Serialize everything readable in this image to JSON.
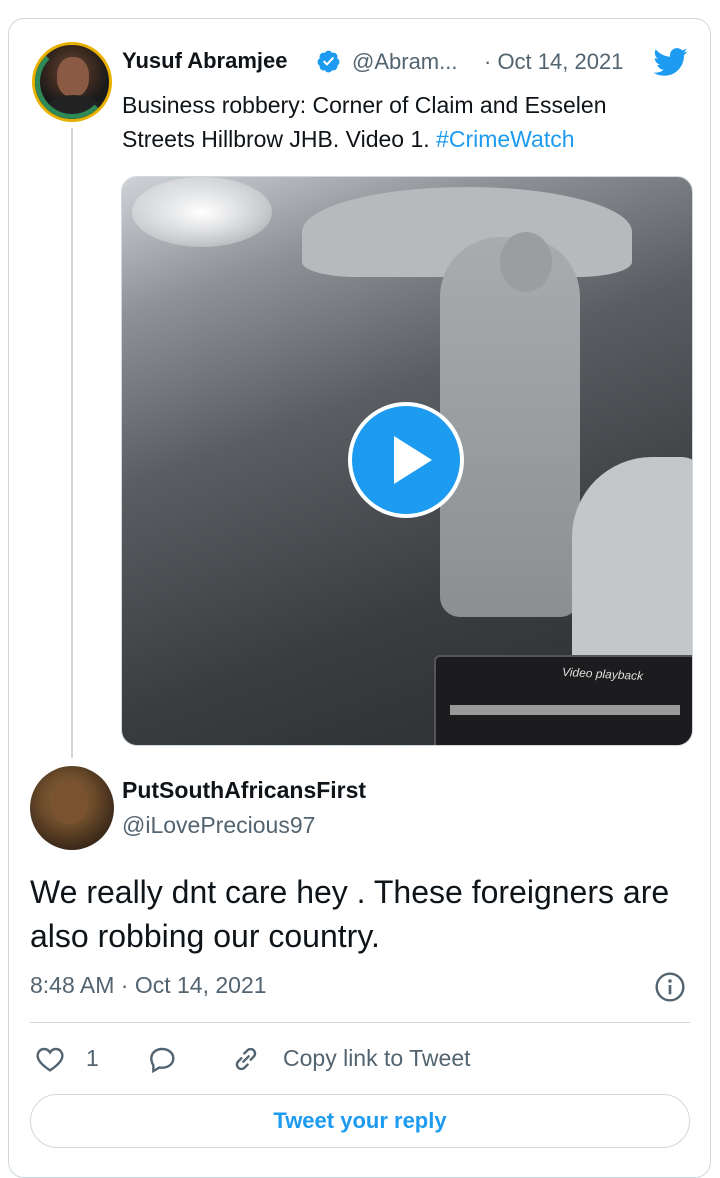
{
  "colors": {
    "accent": "#1d9bf0",
    "text_primary": "#0f1419",
    "text_secondary": "#536471",
    "border": "#cfd9de"
  },
  "original_tweet": {
    "author_name": "Yusuf Abramjee",
    "author_handle": "@Abram...",
    "date": "· Oct 14, 2021",
    "text_before_hashtag": "Business robbery: Corner of Claim and Esselen Streets Hillbrow JHB. Video 1. ",
    "hashtag": "#CrimeWatch",
    "verified_icon": "verified-badge-icon",
    "source_icon": "twitter-bird-icon",
    "media": {
      "type": "video",
      "overlay_text": "Video playback",
      "play_icon": "play-icon"
    }
  },
  "reply_tweet": {
    "author_name": "PutSouthAfricansFirst",
    "author_handle": "@iLovePrecious97",
    "text": "We really dnt care hey . These foreigners are also robbing our country.",
    "timestamp": "8:48 AM · Oct 14, 2021",
    "info_icon": "info-icon"
  },
  "actions": {
    "like_icon": "heart-icon",
    "like_count": "1",
    "reply_icon": "reply-icon",
    "link_icon": "link-icon",
    "copy_link_label": "Copy link to Tweet"
  },
  "reply_button_label": "Tweet your reply"
}
